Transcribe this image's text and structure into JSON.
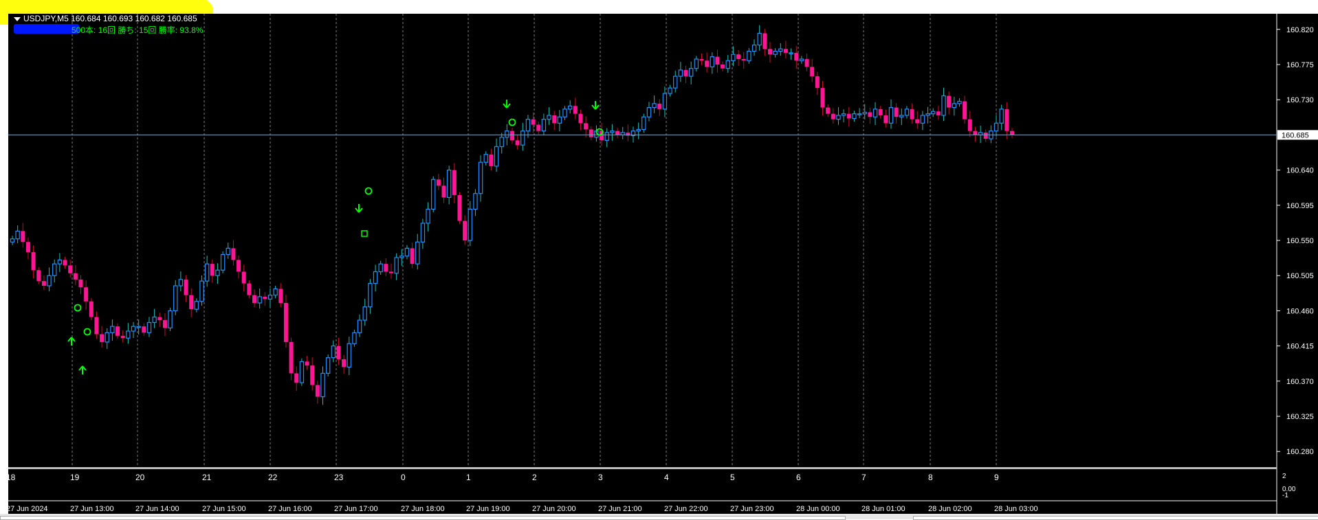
{
  "header": {
    "symbol_line": "USDJPY,M5  160.684 160.693 160.682 160.685",
    "stats_line": "500本: 16回   勝ち: 15回   勝率: 93.8%"
  },
  "price_axis": {
    "ticks": [
      "160.820",
      "160.775",
      "160.730",
      "160.640",
      "160.595",
      "160.550",
      "160.505",
      "160.460",
      "160.415",
      "160.370",
      "160.325",
      "160.280"
    ],
    "current_price": "160.685"
  },
  "indicator_axis": {
    "ticks": [
      "2",
      "0.00",
      "-1"
    ]
  },
  "hour_labels": [
    "18",
    "19",
    "20",
    "21",
    "22",
    "23",
    "0",
    "1",
    "2",
    "3",
    "4",
    "5",
    "6",
    "7",
    "8",
    "9"
  ],
  "time_labels": [
    "27 Jun 2024",
    "27 Jun 13:00",
    "27 Jun 14:00",
    "27 Jun 15:00",
    "27 Jun 16:00",
    "27 Jun 17:00",
    "27 Jun 18:00",
    "27 Jun 19:00",
    "27 Jun 20:00",
    "27 Jun 21:00",
    "27 Jun 22:00",
    "27 Jun 23:00",
    "28 Jun 00:00",
    "28 Jun 01:00",
    "28 Jun 02:00",
    "28 Jun 03:00"
  ],
  "colors": {
    "background": "#000000",
    "bull_candle": "#1e90ff",
    "bear_candle": "#ff1493",
    "grid": "#9a9a9a",
    "signal": "#00ff00",
    "price_line": "#7fa7c8"
  },
  "chart_data": {
    "type": "candlestick",
    "symbol": "USDJPY",
    "timeframe": "M5",
    "ylim": [
      160.26,
      160.84
    ],
    "close_path": [
      160.552,
      160.562,
      160.548,
      160.535,
      160.512,
      160.498,
      160.492,
      160.505,
      160.52,
      160.525,
      160.518,
      160.508,
      160.5,
      160.49,
      160.472,
      160.452,
      160.43,
      160.42,
      160.432,
      160.44,
      160.428,
      160.425,
      160.434,
      160.44,
      160.44,
      160.432,
      160.445,
      160.452,
      160.448,
      160.438,
      160.46,
      160.492,
      160.5,
      160.48,
      160.462,
      160.472,
      160.498,
      160.52,
      160.505,
      160.512,
      160.532,
      160.54,
      160.525,
      160.51,
      160.495,
      160.48,
      160.47,
      160.478,
      160.475,
      160.48,
      160.488,
      160.47,
      160.42,
      160.38,
      160.368,
      160.395,
      160.39,
      160.365,
      160.35,
      160.38,
      160.4,
      160.415,
      160.398,
      160.388,
      160.418,
      160.432,
      160.448,
      160.465,
      160.495,
      160.51,
      160.52,
      160.51,
      160.508,
      160.528,
      160.53,
      160.54,
      160.52,
      160.548,
      160.572,
      160.59,
      160.628,
      160.62,
      160.605,
      160.64,
      160.608,
      160.575,
      160.55,
      160.59,
      160.61,
      160.65,
      160.66,
      160.645,
      160.67,
      160.682,
      160.69,
      160.678,
      160.672,
      160.69,
      160.705,
      160.698,
      160.69,
      160.705,
      160.71,
      160.7,
      160.708,
      160.718,
      160.722,
      160.712,
      160.7,
      160.692,
      160.682,
      160.69,
      160.678,
      160.688,
      160.69,
      160.685,
      160.688,
      160.684,
      160.69,
      160.692,
      160.708,
      160.72,
      160.725,
      160.718,
      160.738,
      160.745,
      160.76,
      160.768,
      160.76,
      160.77,
      160.782,
      160.78,
      160.772,
      160.785,
      160.775,
      160.77,
      160.78,
      160.788,
      160.782,
      160.78,
      160.792,
      160.8,
      160.815,
      160.795,
      160.788,
      160.792,
      160.795,
      160.79,
      160.79,
      160.78,
      160.782,
      160.772,
      160.76,
      160.745,
      160.72,
      160.712,
      160.705,
      160.71,
      160.712,
      160.706,
      160.712,
      160.712,
      160.714,
      160.708,
      160.718,
      160.71,
      160.7,
      160.72,
      160.708,
      160.71,
      160.718,
      160.705,
      160.7,
      160.71,
      160.712,
      160.715,
      160.71,
      160.735,
      160.72,
      160.725,
      160.728,
      160.705,
      160.69,
      160.685,
      160.688,
      160.68,
      160.69,
      160.7,
      160.718,
      160.69,
      160.685
    ]
  }
}
